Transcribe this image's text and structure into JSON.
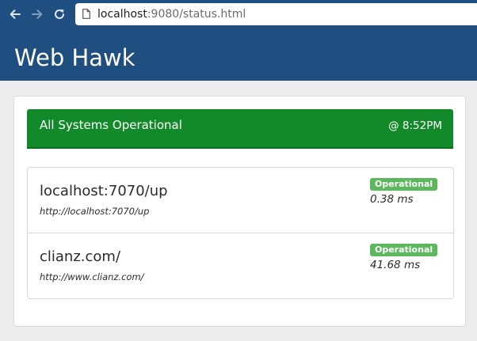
{
  "browser": {
    "url_host": "localhost",
    "url_rest": ":9080/status.html",
    "back_icon": "arrow-left-icon",
    "forward_icon": "arrow-right-icon",
    "reload_icon": "reload-icon",
    "page_icon": "page-icon"
  },
  "header": {
    "title": "Web Hawk"
  },
  "banner": {
    "message": "All Systems Operational",
    "time": "@ 8:52PM",
    "color": "#138a2a"
  },
  "services": [
    {
      "name": "localhost:7070/up",
      "url": "http://localhost:7070/up",
      "status": "Operational",
      "response_time": "0.38 ms"
    },
    {
      "name": "clianz.com/",
      "url": "http://www.clianz.com/",
      "status": "Operational",
      "response_time": "41.68 ms"
    }
  ],
  "colors": {
    "header_bg": "#1f4f80",
    "badge_green": "#5cb85c"
  }
}
